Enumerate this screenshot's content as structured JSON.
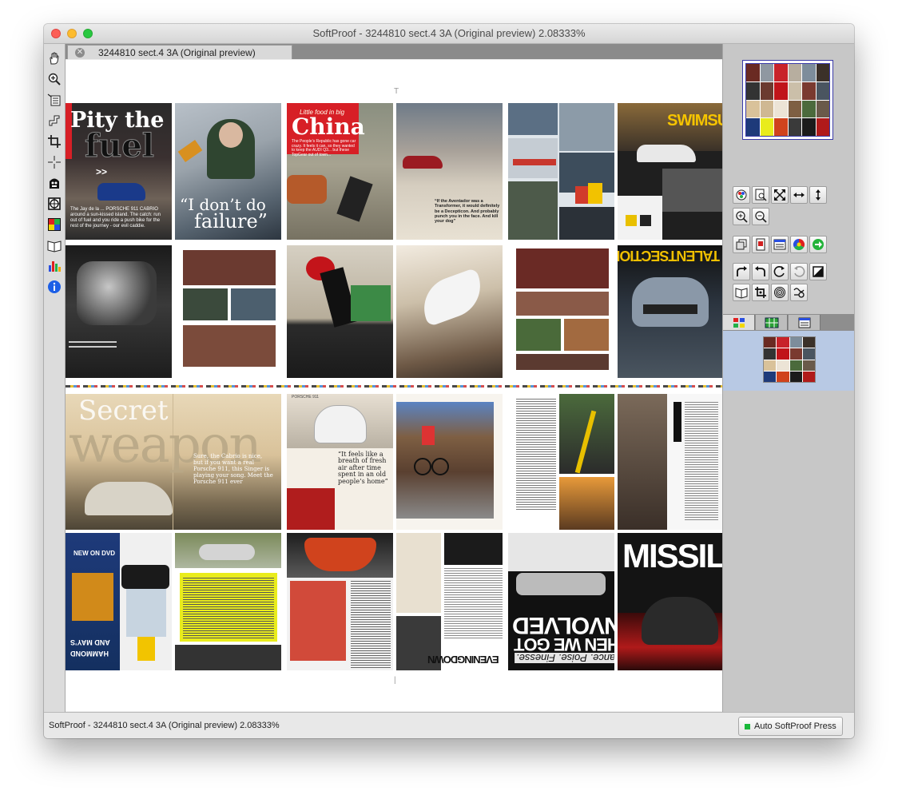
{
  "window": {
    "title": "SoftProof - 3244810  sect.4  3A   (Original preview) 2.08333%"
  },
  "tab": {
    "label": "3244810  sect.4  3A   (Original preview)"
  },
  "left_toolbar": {
    "tools": [
      "hand-icon",
      "zoom-in-icon",
      "page-order-icon",
      "ruler-icon",
      "crop-icon",
      "crosshair-icon",
      "ink-density-icon",
      "grid-target-icon",
      "color-separation-icon",
      "book-icon",
      "histogram-icon",
      "info-icon"
    ]
  },
  "page_texts": {
    "pity_line1": "Pity the",
    "pity_line2": "fuel",
    "pity_arrows": ">>",
    "pity_body": "The Jay de la ... PORSCHE 911 CABRIO around a sun-kissed island. The catch: run out of fuel and you ride a push bike for the rest of the journey - our evil caddie.",
    "failure_q1": "“I don’t do",
    "failure_q2": "failure”",
    "china_small": "Little food in big",
    "china_big": "China",
    "china_sub": "The People’s Republic has gone car crazy. It feels it can, so they wanted to keep the AUDI Q3... but these TopGear out of town...",
    "aventador_quote": "“If the Aventador was a Transformer, it would definitely be a Decepticon. And probably punch you in the face. And kill your dog”",
    "swimsuit": "SWIMSUIT",
    "talent_section": "TALENTSECTION",
    "secret_line1": "Secret",
    "secret_line2": "weapon",
    "secret_body": "Sure, the Cabrio is nice, but if you want a real Porsche 911, this Singer is playing your song. Meet the Porsche 911 ever",
    "porsche_header": "PORSCHE 911",
    "fresh_quote": "“It feels like a breath of fresh air after time spent in an old people’s home”",
    "hammond_line1": "HAMMOND",
    "hammond_line2": "AND MAY’S",
    "new_on_dvd": "NEW ON DVD",
    "evening_down": "EVENINGDOWN",
    "then_we_got": "THEN WE GOT",
    "involved": "INVOLVED",
    "balance": "Balance. Poise. Finesse.",
    "missile": "MISSILE"
  },
  "right_panel": {
    "tools_row1": [
      "color-picker-icon",
      "page-zoom-icon",
      "fit-icon",
      "fit-width-icon",
      "fit-height-icon"
    ],
    "tools_row2": [
      "zoom-in-icon",
      "zoom-out-icon"
    ],
    "tools_row3": [
      "page-layers-icon",
      "pdf-page-icon",
      "page-list-icon",
      "color-wheel-icon",
      "go-arrow-icon"
    ],
    "tools_row4": [
      "redo-icon",
      "undo-icon",
      "refresh-icon",
      "revert-icon",
      "contrast-icon"
    ],
    "tools_row5": [
      "book-view-icon",
      "crop-tool-icon",
      "spiral-icon",
      "curves-icon"
    ],
    "tabs": [
      "thumbnail-tab",
      "grid-tab",
      "list-tab"
    ]
  },
  "statusbar": {
    "text": "SoftProof - 3244810  sect.4  3A   (Original preview) 2.08333%",
    "press_label": "Auto SoftProof Press"
  },
  "colors": {
    "press_led": "#19b83a",
    "china_red": "#d71f26",
    "swimsuit_yellow": "#f5c400",
    "talent_yellow": "#f0c000"
  }
}
